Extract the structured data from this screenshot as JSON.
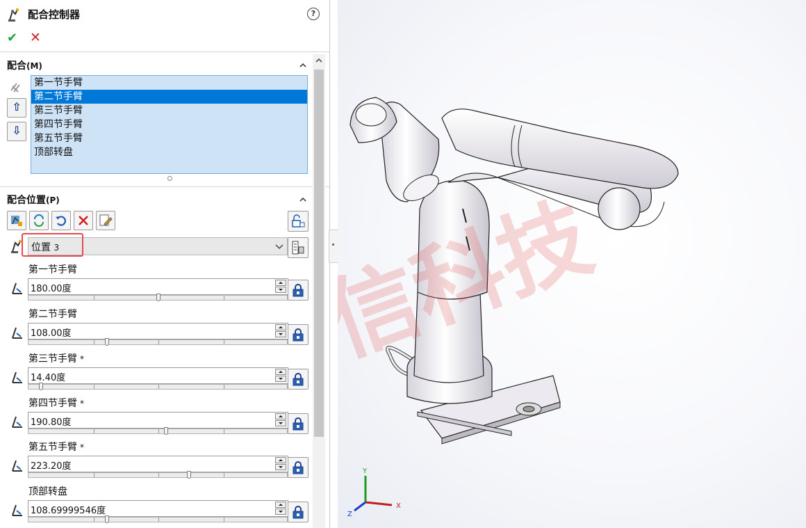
{
  "panel": {
    "title": "配合控制器",
    "help": "?",
    "ok_icon": "checkmark-icon",
    "cancel_icon": "x-icon"
  },
  "mates": {
    "title": "配合",
    "hotkey": "(M)",
    "items": [
      "第一节手臂",
      "第二节手臂",
      "第三节手臂",
      "第四节手臂",
      "第五节手臂",
      "顶部转盘"
    ],
    "selected_index": 1,
    "up_label": "⇧",
    "down_label": "⇩"
  },
  "positions": {
    "title": "配合位置",
    "hotkey": "(P)",
    "selected_position_label": "位置",
    "selected_position_number": "3"
  },
  "joints": [
    {
      "label": "第一节手臂",
      "star": "",
      "value": "180.00度",
      "slider_fraction": 0.5
    },
    {
      "label": "第二节手臂",
      "star": "",
      "value": "108.00度",
      "slider_fraction": 0.3
    },
    {
      "label": "第三节手臂",
      "star": "*",
      "value": "14.40度",
      "slider_fraction": 0.04
    },
    {
      "label": "第四节手臂",
      "star": "*",
      "value": "190.80度",
      "slider_fraction": 0.53
    },
    {
      "label": "第五节手臂",
      "star": "*",
      "value": "223.20度",
      "slider_fraction": 0.62
    },
    {
      "label": "顶部转盘",
      "star": "",
      "value": "108.69999546度",
      "slider_fraction": 0.3
    }
  ],
  "watermark": "华信科技",
  "triad": {
    "x": "X",
    "y": "Y",
    "z": "Z"
  },
  "colors": {
    "selection": "#0078d7",
    "list_bg": "#cfe3f7",
    "highlight_box": "#e8474e",
    "ok": "#22a23a",
    "cancel": "#d42020"
  }
}
